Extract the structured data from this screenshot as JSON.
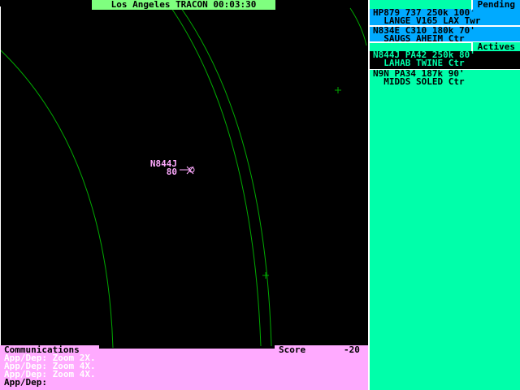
{
  "title": "Los Angeles TRACON 00:03:30",
  "pending": {
    "label": "Pending",
    "strips": [
      {
        "line1": "HP879 737 250k 100'",
        "line2": "  LANGE V165 LAX Twr"
      },
      {
        "line1": "N834E C310 180k 70'",
        "line2": "  SAUGS AHEIM Ctr"
      }
    ]
  },
  "actives": {
    "label": "Actives",
    "strips": [
      {
        "line1": "N844J PA42 250k 80'",
        "line2": "  LAHAB TWINE Ctr",
        "selected": true
      },
      {
        "line1": "N9N PA34 187k 90'",
        "line2": "  MIDDS SOLED Ctr"
      }
    ]
  },
  "aircraft": {
    "callsign": "N844J",
    "altitude": "80"
  },
  "comms": {
    "label": "Communications",
    "score_label": "Score",
    "score": "-20",
    "messages": [
      "App/Dep: Zoom 2X.",
      "App/Dep: Zoom 4X.",
      "App/Dep: Zoom 4X."
    ],
    "prompt": "App/Dep:"
  },
  "colors": {
    "pending": "#00aaff",
    "actives": "#00ffaa",
    "comms": "#ffaaff",
    "title": "#7fff7f"
  }
}
